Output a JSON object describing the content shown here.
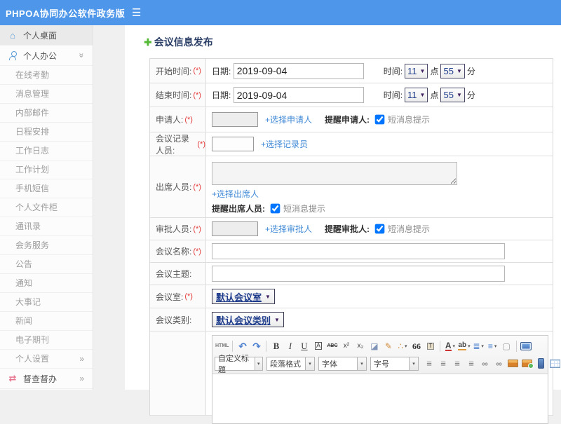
{
  "ui": {
    "menu_icon": "☰",
    "chevron": "»",
    "dropdown_arrow": "▼",
    "small_arrow": "▾",
    "plus_icon": "✚",
    "home_icon": "⌂",
    "shuffle_icon": "⇄"
  },
  "colors": {
    "topbar": "#4e96e9",
    "link": "#418ad6",
    "required": "#e53c3c",
    "select_text": "#1f3d8c",
    "icon_blue": "#5b9bd5",
    "icon_pink": "#e8738e",
    "title_navy": "#2b3f66",
    "plus_green": "#55b837"
  },
  "topbar": {
    "title": "PHPOA协同办公软件政务版"
  },
  "sidebar": {
    "desktop": {
      "label": "个人桌面"
    },
    "office": {
      "label": "个人办公"
    },
    "submenu": [
      "在线考勤",
      "消息管理",
      "内部邮件",
      "日程安排",
      "工作日志",
      "工作计划",
      "手机短信",
      "个人文件柜",
      "通讯录",
      "会务服务",
      "公告",
      "通知",
      "大事记",
      "新闻",
      "电子期刊"
    ],
    "settings": {
      "label": "个人设置"
    },
    "supervision": {
      "label": "督查督办"
    }
  },
  "form": {
    "title": "会议信息发布",
    "required_mark": "(*)",
    "rows": {
      "start_time": {
        "label": "开始时间:",
        "date_label": "日期:",
        "date_value": "2019-09-04",
        "time_label": "时间:",
        "hour": "11",
        "hour_suffix": "点",
        "minute": "55",
        "minute_suffix": "分"
      },
      "end_time": {
        "label": "结束时间:",
        "date_label": "日期:",
        "date_value": "2019-09-04",
        "time_label": "时间:",
        "hour": "11",
        "hour_suffix": "点",
        "minute": "55",
        "minute_suffix": "分"
      },
      "applicant": {
        "label": "申请人:",
        "value": "",
        "link": "+选择申请人",
        "remind_label": "提醒申请人:",
        "checked": true,
        "sms_label": "短消息提示"
      },
      "recorder": {
        "label": "会议记录人员:",
        "value": "",
        "link": "+选择记录员"
      },
      "attendees": {
        "label": "出席人员:",
        "value": "",
        "link": "+选择出席人",
        "remind_label": "提醒出席人员:",
        "checked": true,
        "sms_label": "短消息提示"
      },
      "approver": {
        "label": "审批人员:",
        "value": "",
        "link": "+选择审批人",
        "remind_label": "提醒审批人:",
        "checked": true,
        "sms_label": "短消息提示"
      },
      "meeting_name": {
        "label": "会议名称:",
        "value": ""
      },
      "meeting_topic": {
        "label": "会议主题:",
        "value": ""
      },
      "meeting_room": {
        "label": "会议室:",
        "value": "默认会议室"
      },
      "meeting_type": {
        "label": "会议类别:",
        "value": "默认会议类别"
      }
    }
  },
  "editor": {
    "toolbar_row1": [
      {
        "name": "html-source-icon",
        "glyph": "HTML"
      },
      {
        "name": "undo-icon",
        "glyph": "↶"
      },
      {
        "name": "redo-icon",
        "glyph": "↷"
      },
      {
        "name": "bold-icon",
        "glyph": "B"
      },
      {
        "name": "italic-icon",
        "glyph": "I"
      },
      {
        "name": "underline-icon",
        "glyph": "U"
      },
      {
        "name": "font-border-icon",
        "glyph": "A"
      },
      {
        "name": "strikethrough-icon",
        "glyph": "ABC"
      },
      {
        "name": "superscript-icon",
        "glyph": "x²"
      },
      {
        "name": "subscript-icon",
        "glyph": "x₂"
      },
      {
        "name": "eraser-icon",
        "glyph": "◪"
      },
      {
        "name": "format-painter-icon",
        "glyph": "✎"
      },
      {
        "name": "auto-typeset-icon",
        "glyph": "∴"
      },
      {
        "name": "blockquote-icon",
        "glyph": "66"
      },
      {
        "name": "paste-text-icon",
        "glyph": "T"
      },
      {
        "name": "font-color-icon",
        "glyph": "A"
      },
      {
        "name": "highlight-color-icon",
        "glyph": "ab"
      },
      {
        "name": "ordered-list-icon",
        "glyph": "≣"
      },
      {
        "name": "unordered-list-icon",
        "glyph": "≡"
      },
      {
        "name": "blank-page-icon",
        "glyph": "▢"
      },
      {
        "name": "preview-icon",
        "glyph": ""
      }
    ],
    "toolbar_selects": [
      "自定义标题",
      "段落格式",
      "字体",
      "字号"
    ],
    "toolbar_row2_icons": [
      {
        "name": "align-left-icon",
        "glyph": "≡"
      },
      {
        "name": "align-center-icon",
        "glyph": "≡"
      },
      {
        "name": "align-right-icon",
        "glyph": "≡"
      },
      {
        "name": "align-justify-icon",
        "glyph": "≡"
      },
      {
        "name": "link-icon",
        "glyph": "∞"
      },
      {
        "name": "unlink-icon",
        "glyph": "∞"
      }
    ]
  }
}
